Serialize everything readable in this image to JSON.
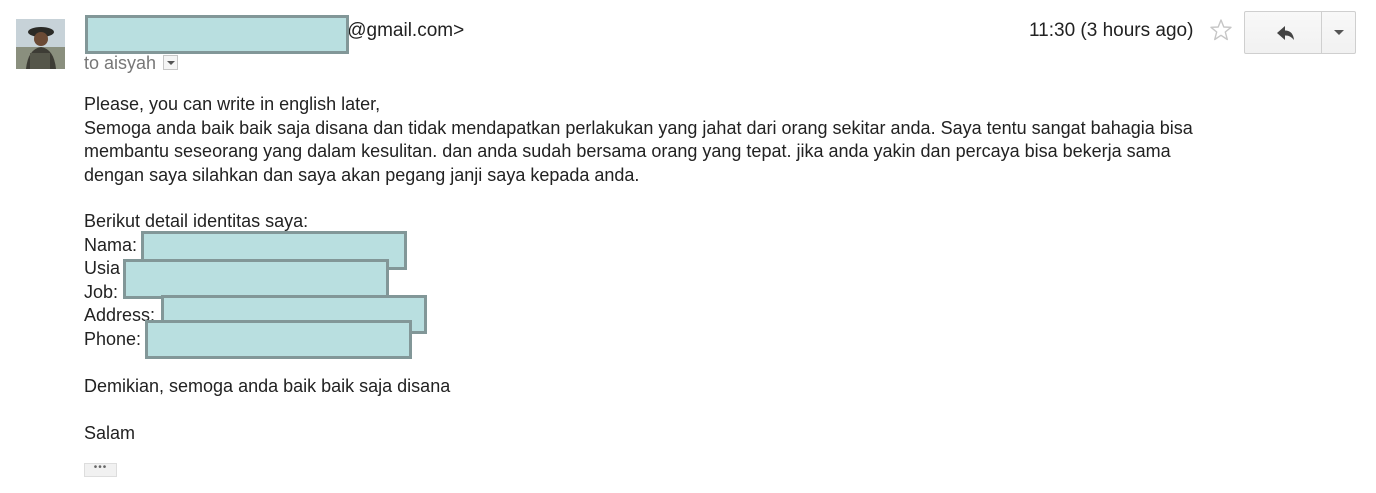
{
  "header": {
    "sender_email_suffix": "i@gmail.com>",
    "to_label": "to aisyah",
    "timestamp": "11:30 (3 hours ago)"
  },
  "icons": {
    "star": "star-outline-icon",
    "reply": "reply-arrow-icon",
    "more": "chevron-down-icon",
    "details": "details-toggle-icon"
  },
  "message": {
    "greeting": "Please, you can write in english later,",
    "paragraph_lines": [
      "Semoga anda baik baik saja disana dan tidak mendapatkan perlakukan yang jahat dari orang sekitar anda. Saya tentu sangat bahagia bisa",
      "membantu seseorang yang dalam kesulitan. dan anda sudah bersama orang yang tepat. jika anda yakin dan percaya bisa bekerja sama",
      "dengan saya silahkan dan saya akan pegang janji saya kepada anda."
    ],
    "identity_intro": "Berikut detail identitas saya:",
    "fields": {
      "name_label": "Nama:",
      "age_label": "Usia",
      "job_label": "Job:",
      "address_label": "Address:",
      "phone_label": "Phone:"
    },
    "closing": "Demikian, semoga anda baik baik saja disana",
    "signoff": "Salam"
  },
  "trimmed_content_label": "•••",
  "colors": {
    "redaction_fill": "#b9dfe0",
    "redaction_border": "#829798"
  }
}
